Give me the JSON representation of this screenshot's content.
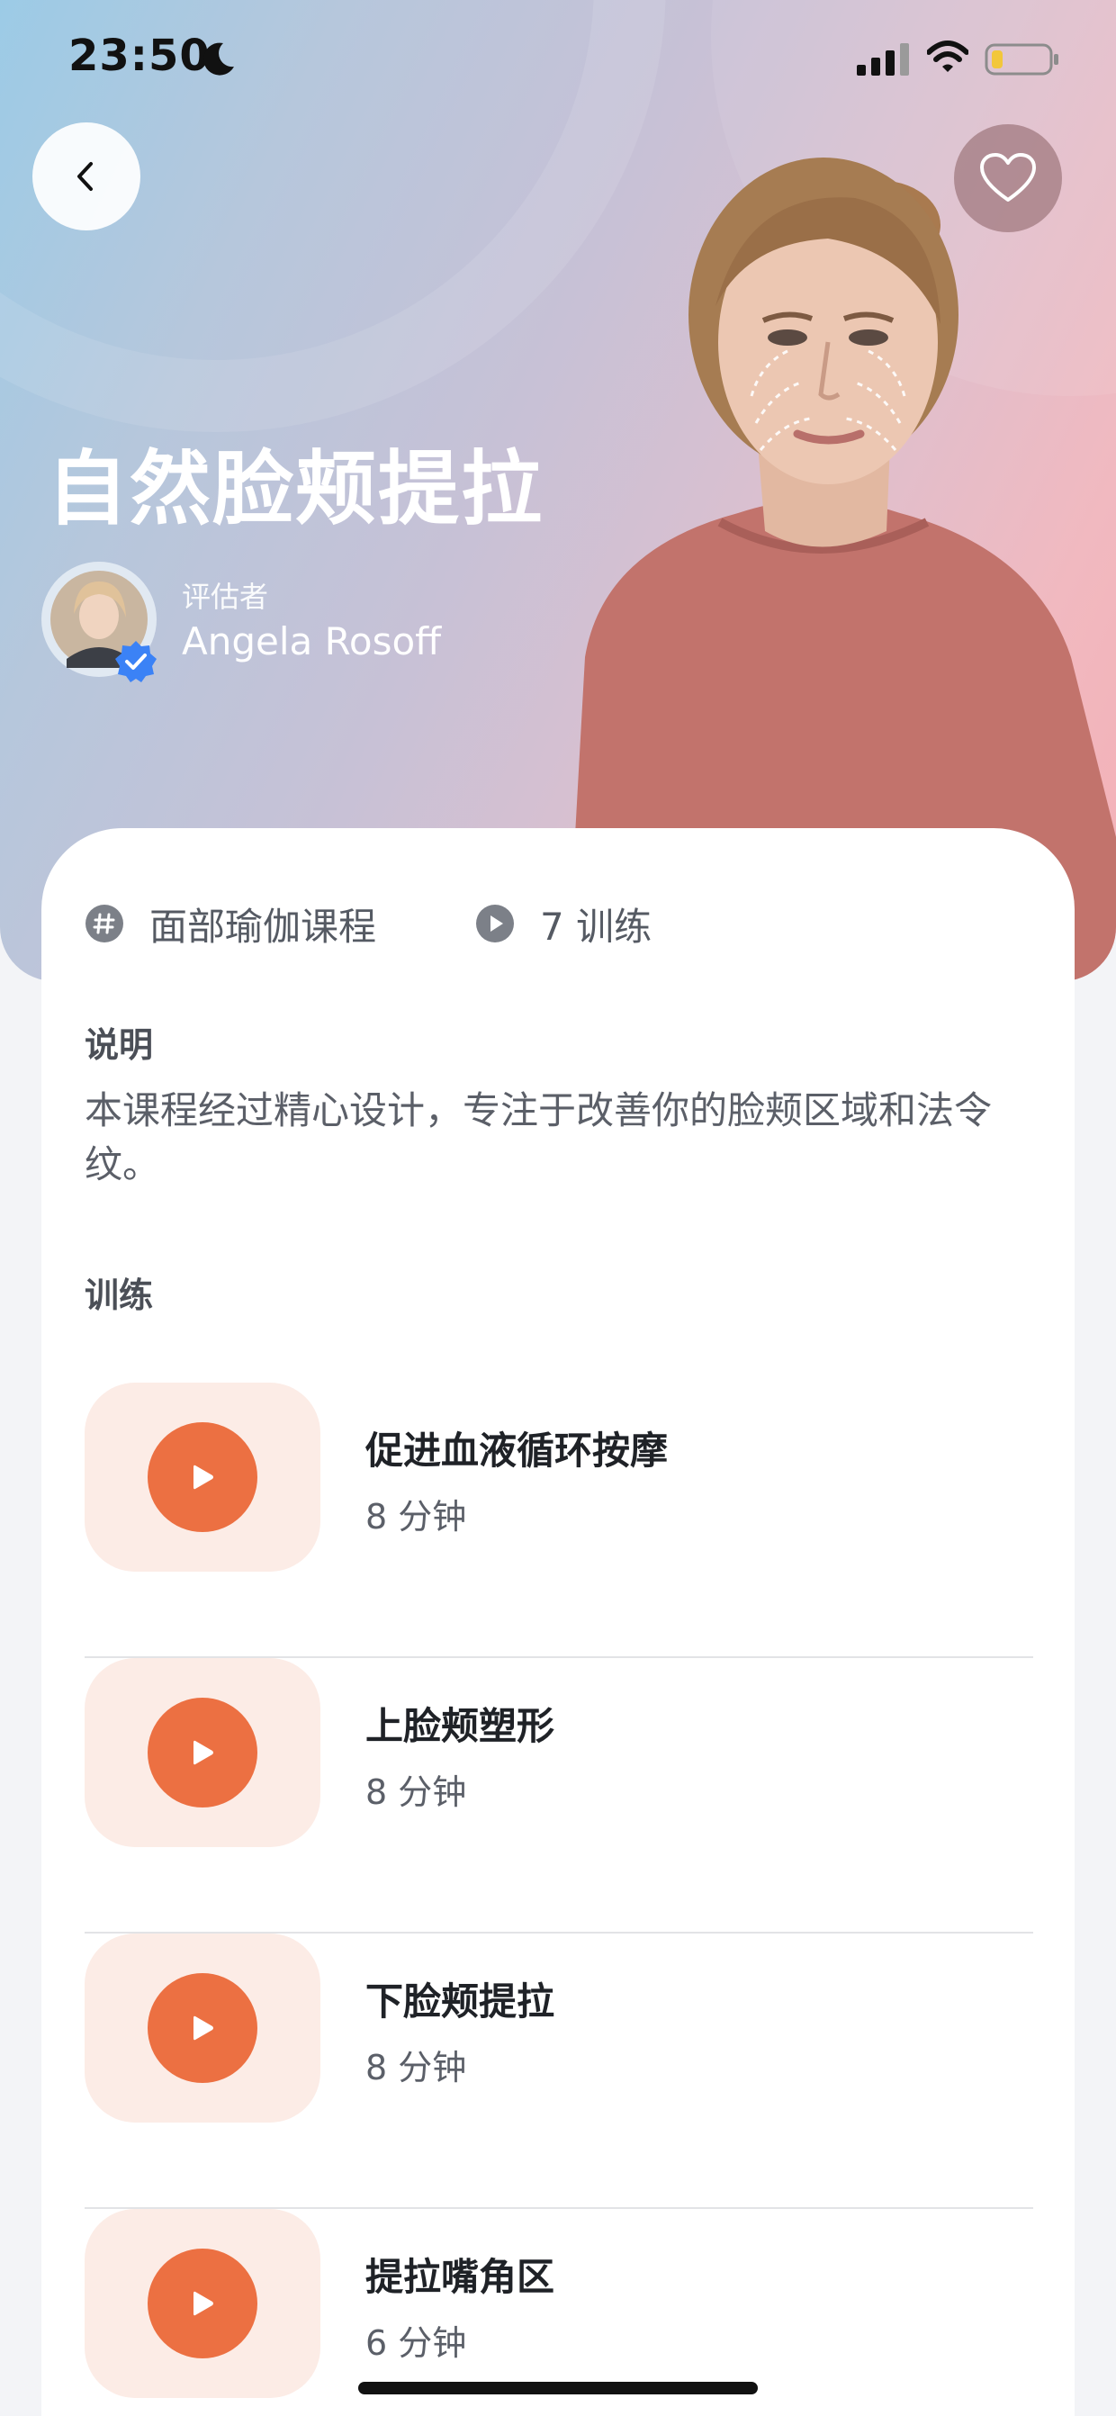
{
  "status_bar": {
    "time": "23:50",
    "icons": [
      "moon-icon",
      "signal-icon",
      "wifi-icon",
      "battery-icon"
    ]
  },
  "nav": {
    "back_icon": "chevron-left-icon",
    "favorite_icon": "heart-icon"
  },
  "hero": {
    "title": "自然脸颊提拉",
    "author_role": "评估者",
    "author_name": "Angela Rosoff"
  },
  "meta": {
    "category": "面部瑜伽课程",
    "lessons_count": "7 训练"
  },
  "description": {
    "title": "说明",
    "text": "本课程经过精心设计，专注于改善你的脸颊区域和法令纹。"
  },
  "trainings": {
    "title": "训练",
    "items": [
      {
        "name": "促进血液循环按摩",
        "duration": "8 分钟"
      },
      {
        "name": "上脸颊塑形",
        "duration": "8 分钟"
      },
      {
        "name": "下脸颊提拉",
        "duration": "8 分钟"
      },
      {
        "name": "提拉嘴角区",
        "duration": "6 分钟"
      }
    ]
  },
  "colors": {
    "accent": "#ec7042",
    "thumb_bg": "#fcece6",
    "verified": "#3b82f6"
  }
}
